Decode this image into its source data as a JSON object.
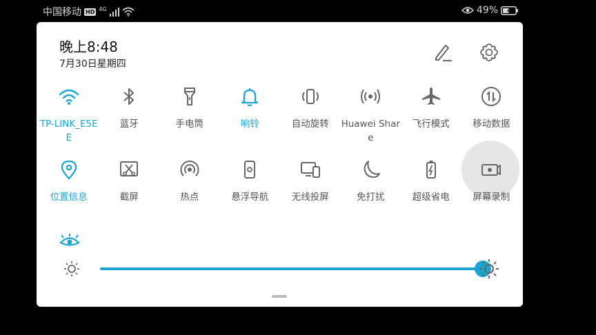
{
  "status_bar": {
    "carrier": "中国移动",
    "hd_badge": "HD",
    "network_type": "4G",
    "battery": "49%"
  },
  "panel": {
    "time": "晚上8:48",
    "date": "7月30日星期四"
  },
  "colors": {
    "accent": "#1aa5d3",
    "inactive": "#666666",
    "pressed": "#e6e6e6"
  },
  "tiles": [
    {
      "label": "TP-LINK_E5EE",
      "icon": "wifi-icon",
      "active": true
    },
    {
      "label": "蓝牙",
      "icon": "bluetooth-icon",
      "active": false
    },
    {
      "label": "手电筒",
      "icon": "flashlight-icon",
      "active": false
    },
    {
      "label": "响铃",
      "icon": "bell-icon",
      "active": true
    },
    {
      "label": "自动旋转",
      "icon": "rotate-icon",
      "active": false
    },
    {
      "label": "Huawei Share",
      "icon": "huawei-share-icon",
      "active": false
    },
    {
      "label": "飞行模式",
      "icon": "airplane-icon",
      "active": false
    },
    {
      "label": "移动数据",
      "icon": "mobile-data-icon",
      "active": false
    },
    {
      "label": "位置信息",
      "icon": "location-icon",
      "active": true
    },
    {
      "label": "截屏",
      "icon": "screenshot-icon",
      "active": false
    },
    {
      "label": "热点",
      "icon": "hotspot-icon",
      "active": false
    },
    {
      "label": "悬浮导航",
      "icon": "floating-nav-icon",
      "active": false
    },
    {
      "label": "无线投屏",
      "icon": "wireless-projection-icon",
      "active": false
    },
    {
      "label": "免打扰",
      "icon": "moon-icon",
      "active": false
    },
    {
      "label": "超级省电",
      "icon": "battery-saver-icon",
      "active": false
    },
    {
      "label": "屏幕录制",
      "icon": "screen-record-icon",
      "active": false,
      "pressed": true
    }
  ],
  "brightness": {
    "level": 1.0
  }
}
